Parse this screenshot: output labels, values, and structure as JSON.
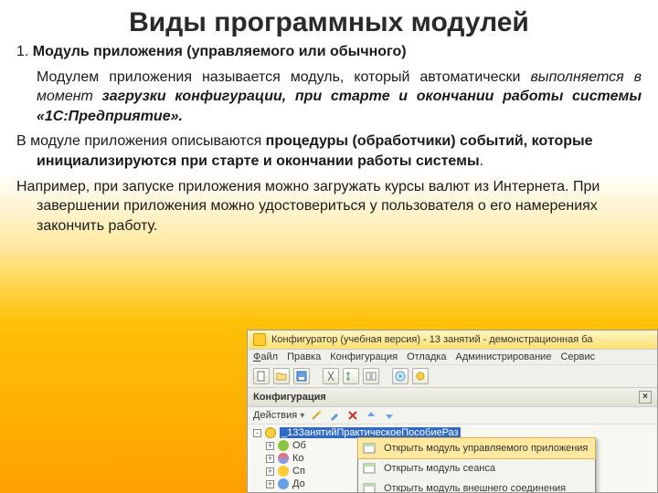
{
  "slide": {
    "title": "Виды программных модулей",
    "p1_prefix": "1. ",
    "p1_bold": "Модуль приложения (управляемого или обычного)",
    "p2_a": "Модулем приложения называется модуль, который автоматически ",
    "p2_b_italic": "выполняется в момент ",
    "p2_c_bolditalic": "загрузки конфигурации, при старте и окончании работы системы «1С:Предприятие».",
    "p3_a": "В модуле приложения описываются ",
    "p3_b_bold": "процедуры (обработчики) событий, которые инициализируются при старте и окончании работы системы",
    "p3_c": ".",
    "p4": "Например, при запуске приложения можно загружать курсы валют из Интернета. При завершении приложения можно удостовериться у пользователя о его намерениях закончить работу."
  },
  "app": {
    "title": "Конфигуратор (учебная версия) - 13 занятий - демонстрационная ба",
    "menu": {
      "file": "Файл",
      "edit": "Правка",
      "config": "Конфигурация",
      "debug": "Отладка",
      "admin": "Администрирование",
      "service": "Сервис"
    },
    "panel": {
      "title": "Конфигурация",
      "close": "×",
      "actions": "Действия"
    },
    "tree": {
      "root": "_13ЗанятийПрактическоеПособиеРаз",
      "n1": "Об",
      "n2": "Ко",
      "n3": "Сп",
      "n4": "До"
    },
    "ctx": {
      "item1": "Открыть модуль управляемого приложения",
      "item2": "Открыть модуль сеанса",
      "item3": "Открыть модуль внешнего соединения"
    }
  }
}
